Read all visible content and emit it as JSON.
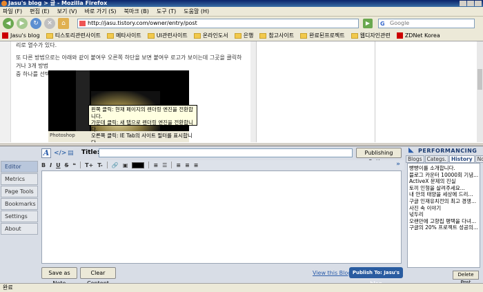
{
  "window": {
    "title": "Jasu's blog > 글 - Mozilla Firefox"
  },
  "menu": [
    "파일 (F)",
    "편집 (E)",
    "보기 (V)",
    "바로 가기 (S)",
    "북마크 (B)",
    "도구 (T)",
    "도움말 (H)"
  ],
  "nav": {
    "url": "http://jasu.tistory.com/owner/entry/post",
    "search_placeholder": "Google"
  },
  "bookmarks": [
    {
      "label": "Jasu's blog",
      "kind": "site"
    },
    {
      "label": "티스토리관련사이트",
      "kind": "folder"
    },
    {
      "label": "메타사이트",
      "kind": "folder"
    },
    {
      "label": "UI관련사이트",
      "kind": "folder"
    },
    {
      "label": "온라인도서",
      "kind": "folder"
    },
    {
      "label": "은행",
      "kind": "folder"
    },
    {
      "label": "참고사이트",
      "kind": "folder"
    },
    {
      "label": "완료된프로젝트",
      "kind": "folder"
    },
    {
      "label": "웹디자인관련",
      "kind": "folder"
    },
    {
      "label": "ZDNet Korea",
      "kind": "site"
    }
  ],
  "content": {
    "line1": "리로 열수가 있다.",
    "line2": "또 다른 방법으로는 아래와 같이 붙여우 오른쪽 하단을 보면 붙여우 로고가 보이는데 그곳을 클릭하거나 3개 방법",
    "line3": "중 하나를 선택하여도 위와 같이 IE로 열 수가 있다.",
    "screenshot_caption": "Photoshop",
    "tooltip": [
      "왼쪽 클릭: 현재 페이지의 렌더링 엔진을 전환합니다.",
      "가운데 클릭: 새 탭으로 렌더링 엔진을 전환합니다.",
      "오른쪽 클릭: IE Tab의 사이트 필터를 표시합니다."
    ]
  },
  "performancing": {
    "sidebar": [
      "Editor",
      "Metrics",
      "Page Tools",
      "Bookmarks",
      "Settings",
      "About"
    ],
    "title_label": "Title:",
    "title_value": "",
    "publishing_options": "Publishing Options",
    "toolbar": [
      "B",
      "I",
      "U",
      "S",
      "T+",
      "T-"
    ],
    "buttons": {
      "save_as_note": "Save as Note",
      "clear_content": "Clear Content",
      "view_blog": "View this Blog",
      "publish": "Publish To:  Jasu's blog"
    },
    "brand": "PERFORMANCING",
    "tabs": [
      "Blogs",
      "Categs.",
      "History",
      "Notes"
    ],
    "history": [
      "빵빵이를 소개합니다.",
      "블로그 카운터 10000회 기념...",
      "ActiveX 문제의 진실",
      "토끼 인형을 살려주세요...",
      "내 안의 태양을 세상에 드리...",
      "구글 인재유치전의 최고 경쟁...",
      "사진 속 이야기",
      "넋두리",
      "오랜만에 고향집 평택을 다녀...",
      "구글의 20% 프로젝트 성공의..."
    ],
    "delete_post": "Delete Post"
  },
  "status": {
    "text": "완료"
  }
}
